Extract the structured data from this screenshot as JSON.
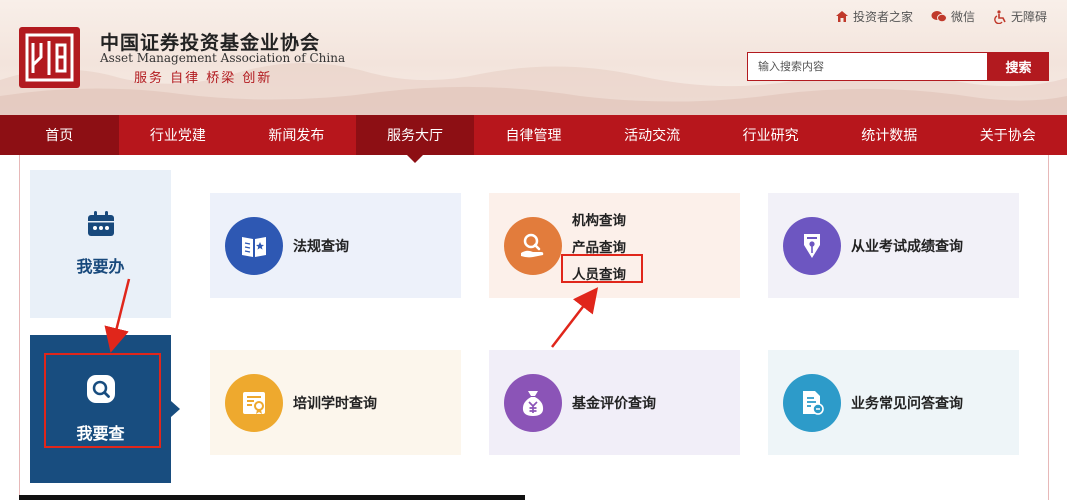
{
  "brand": {
    "name_cn": "中国证券投资基金业协会",
    "name_en": "Asset Management Association of China",
    "slogan": "服务 自律 桥梁 创新"
  },
  "top_links": [
    {
      "label": "投资者之家",
      "icon": "home-icon"
    },
    {
      "label": "微信",
      "icon": "wechat-icon"
    },
    {
      "label": "无障碍",
      "icon": "accessibility-icon"
    }
  ],
  "search": {
    "placeholder": "输入搜索内容",
    "button_label": "搜索"
  },
  "nav": {
    "items": [
      {
        "label": "首页"
      },
      {
        "label": "行业党建"
      },
      {
        "label": "新闻发布"
      },
      {
        "label": "服务大厅"
      },
      {
        "label": "自律管理"
      },
      {
        "label": "活动交流"
      },
      {
        "label": "行业研究"
      },
      {
        "label": "统计数据"
      },
      {
        "label": "关于协会"
      }
    ],
    "active": "服务大厅"
  },
  "side_tabs": {
    "do": {
      "label": "我要办",
      "icon": "calendar-icon"
    },
    "check": {
      "label": "我要查",
      "icon": "search-icon"
    }
  },
  "cards": {
    "regulations": {
      "label": "法规查询",
      "icon": "book-icon"
    },
    "institution": {
      "links": [
        "机构查询",
        "产品查询",
        "人员查询"
      ],
      "icon": "hand-search-icon"
    },
    "exam": {
      "label": "从业考试成绩查询",
      "icon": "pen-nib-icon"
    },
    "training": {
      "label": "培训学时查询",
      "icon": "certificate-icon"
    },
    "fund_rating": {
      "label": "基金评价查询",
      "icon": "money-bag-icon"
    },
    "faq": {
      "label": "业务常见问答查询",
      "icon": "document-chat-icon"
    }
  },
  "colors": {
    "brand_red": "#b7161c",
    "nav_active": "#8d0f14",
    "tab_blue": "#184d7f",
    "annotation_red": "#e0261b"
  }
}
